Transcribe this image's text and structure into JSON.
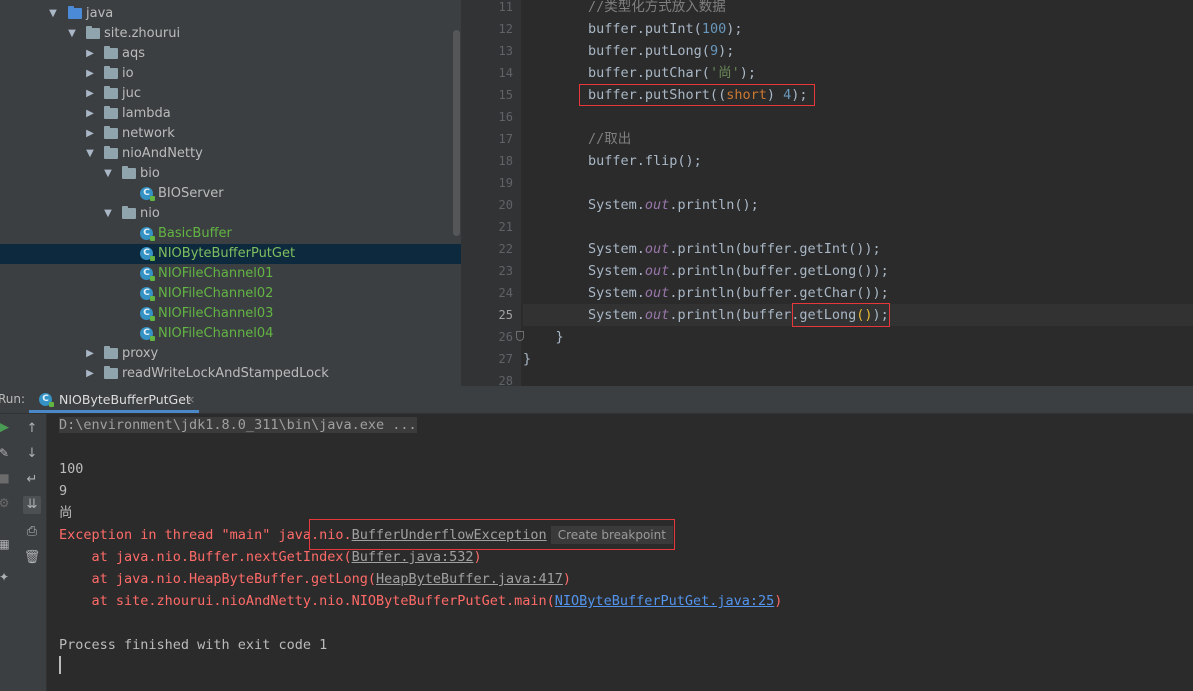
{
  "project_tree": {
    "items": [
      {
        "label": "java",
        "kind": "folder-blue",
        "expanded": true
      },
      {
        "label": "site.zhourui",
        "kind": "package",
        "expanded": true
      },
      {
        "label": "aqs",
        "kind": "package",
        "expanded": false
      },
      {
        "label": "io",
        "kind": "package",
        "expanded": false
      },
      {
        "label": "juc",
        "kind": "package",
        "expanded": false
      },
      {
        "label": "lambda",
        "kind": "package",
        "expanded": false
      },
      {
        "label": "network",
        "kind": "package",
        "expanded": false
      },
      {
        "label": "nioAndNetty",
        "kind": "package",
        "expanded": true
      },
      {
        "label": "bio",
        "kind": "package",
        "expanded": true
      },
      {
        "label": "BIOServer",
        "kind": "class"
      },
      {
        "label": "nio",
        "kind": "package",
        "expanded": true
      },
      {
        "label": "BasicBuffer",
        "kind": "class"
      },
      {
        "label": "NIOByteBufferPutGet",
        "kind": "class",
        "selected": true
      },
      {
        "label": "NIOFileChannel01",
        "kind": "class"
      },
      {
        "label": "NIOFileChannel02",
        "kind": "class"
      },
      {
        "label": "NIOFileChannel03",
        "kind": "class"
      },
      {
        "label": "NIOFileChannel04",
        "kind": "class"
      },
      {
        "label": "proxy",
        "kind": "package",
        "expanded": false
      },
      {
        "label": "readWriteLockAndStampedLock",
        "kind": "package",
        "expanded": false
      }
    ]
  },
  "editor": {
    "current_line": 25,
    "lines": [
      {
        "n": "11",
        "code": "//类型化方式放入数据"
      },
      {
        "n": "12",
        "code": "buffer.putInt(100);"
      },
      {
        "n": "13",
        "code": "buffer.putLong(9);"
      },
      {
        "n": "14",
        "code": "buffer.putChar('尚');"
      },
      {
        "n": "15",
        "code": "buffer.putShort((short) 4);"
      },
      {
        "n": "16",
        "code": ""
      },
      {
        "n": "17",
        "code": "//取出"
      },
      {
        "n": "18",
        "code": "buffer.flip();"
      },
      {
        "n": "19",
        "code": ""
      },
      {
        "n": "20",
        "code": "System.out.println();"
      },
      {
        "n": "21",
        "code": ""
      },
      {
        "n": "22",
        "code": "System.out.println(buffer.getInt());"
      },
      {
        "n": "23",
        "code": "System.out.println(buffer.getLong());"
      },
      {
        "n": "24",
        "code": "System.out.println(buffer.getChar());"
      },
      {
        "n": "25",
        "code": "System.out.println(buffer.getLong());"
      },
      {
        "n": "26",
        "code": "}"
      },
      {
        "n": "27",
        "code": "}"
      },
      {
        "n": "28",
        "code": ""
      }
    ]
  },
  "run_panel": {
    "label": "Run:",
    "tab_title": "NIOByteBufferPutGet",
    "tab_close": "×",
    "console": {
      "command": "D:\\environment\\jdk1.8.0_311\\bin\\java.exe ...",
      "out1": "100",
      "out2": "9",
      "out3": "尚",
      "exception_prefix": "Exception in thread \"main\" java.nio.",
      "exception_class": "BufferUnderflowException",
      "breakpoint_hint": "Create breakpoint",
      "trace": [
        {
          "prefix": "    at java.nio.Buffer.nextGetIndex(",
          "link": "Buffer.java:532",
          "suffix": ")"
        },
        {
          "prefix": "    at java.nio.HeapByteBuffer.getLong(",
          "link": "HeapByteBuffer.java:417",
          "suffix": ")"
        },
        {
          "prefix": "    at site.zhourui.nioAndNetty.nio.NIOByteBufferPutGet.main(",
          "link": "NIOByteBufferPutGet.java:25",
          "suffix": ")"
        }
      ],
      "exit": "Process finished with exit code 1"
    }
  }
}
